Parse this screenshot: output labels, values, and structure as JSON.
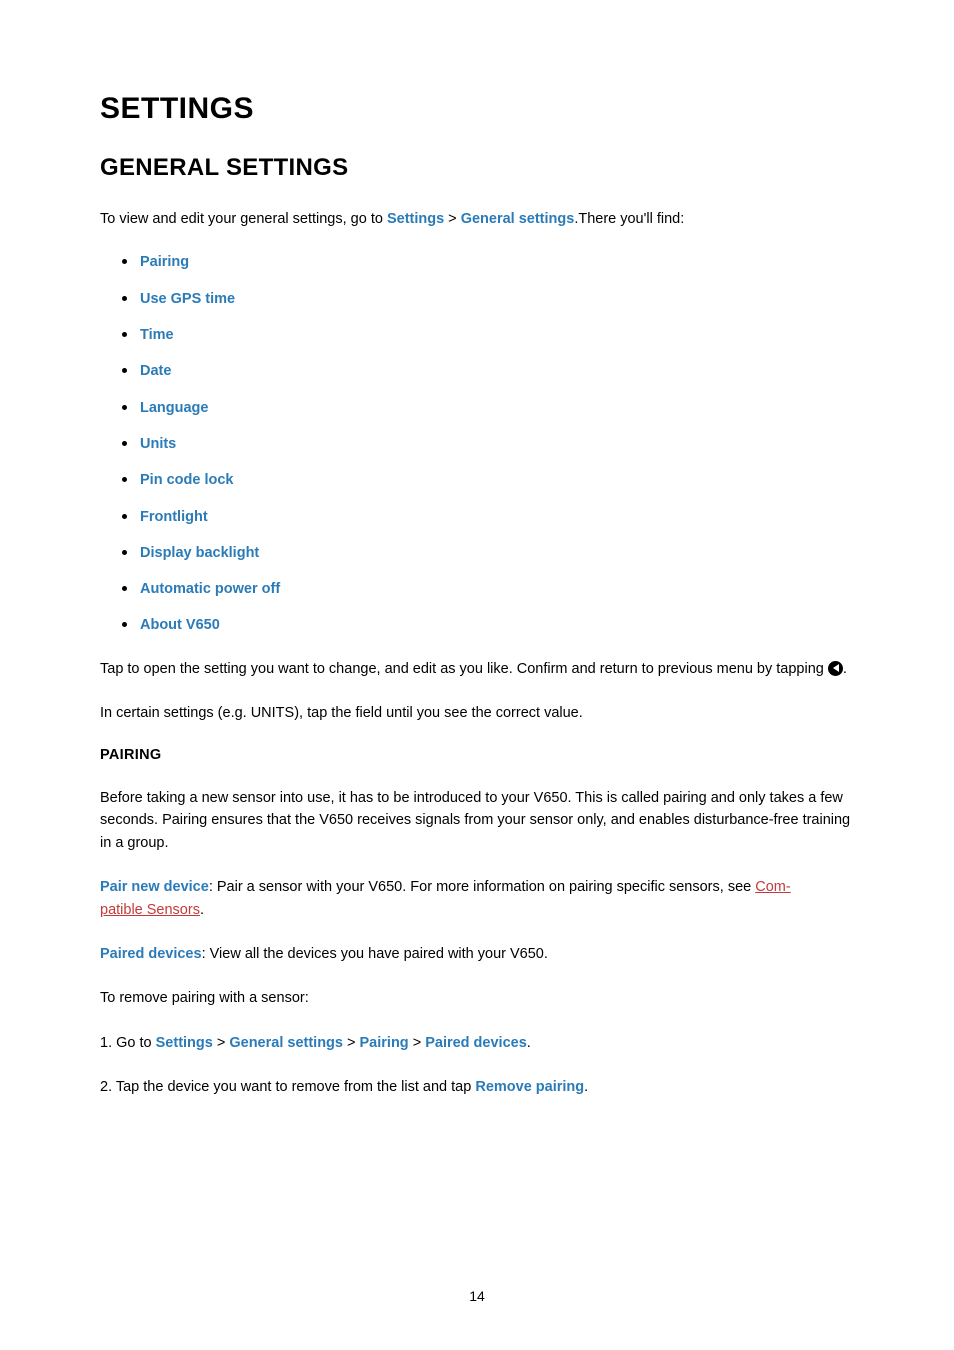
{
  "h1": "SETTINGS",
  "h2": "GENERAL SETTINGS",
  "intro_a": "To view and edit your general settings, go to ",
  "intro_b": "Settings",
  "intro_c": " > ",
  "intro_d": "General settings",
  "intro_e": ".There you'll find:",
  "items": [
    "Pairing",
    "Use GPS time",
    "Time",
    "Date",
    "Language",
    "Units",
    "Pin code lock",
    "Frontlight",
    "Display backlight",
    "Automatic power off",
    "About V650"
  ],
  "tap_a": "Tap to open the setting you want to change, and edit as you like. Confirm and return to previous menu by tapping ",
  "tap_b": ".",
  "certain": "In certain settings (e.g. UNITS), tap the field until you see the correct value.",
  "pairing_h": "PAIRING",
  "pairing_p": "Before taking a new sensor into use, it has to be introduced to your V650. This is called pairing and only takes a few seconds. Pairing ensures that the V650 receives signals from your sensor only, and enables disturbance-free training in a group.",
  "pnd_a": "Pair new device",
  "pnd_b": ": Pair a sensor with your V650. For more information on pairing specific sensors, see ",
  "pnd_link1": "Com-",
  "pnd_link2": "patible Sensors",
  "pnd_c": ".",
  "pd_a": "Paired devices",
  "pd_b": ": View all the devices you have paired with your V650.",
  "rm_intro": "To remove pairing with a sensor:",
  "s1_a": "1. Go to ",
  "s1_b": "Settings",
  "s1_c": " > ",
  "s1_d": "General settings",
  "s1_e": " > ",
  "s1_f": "Pairing",
  "s1_g": " > ",
  "s1_h": "Paired devices",
  "s1_i": ".",
  "s2_a": "2. Tap the device you want to remove from the list and tap ",
  "s2_b": "Remove pairing",
  "s2_c": ".",
  "page": "14"
}
